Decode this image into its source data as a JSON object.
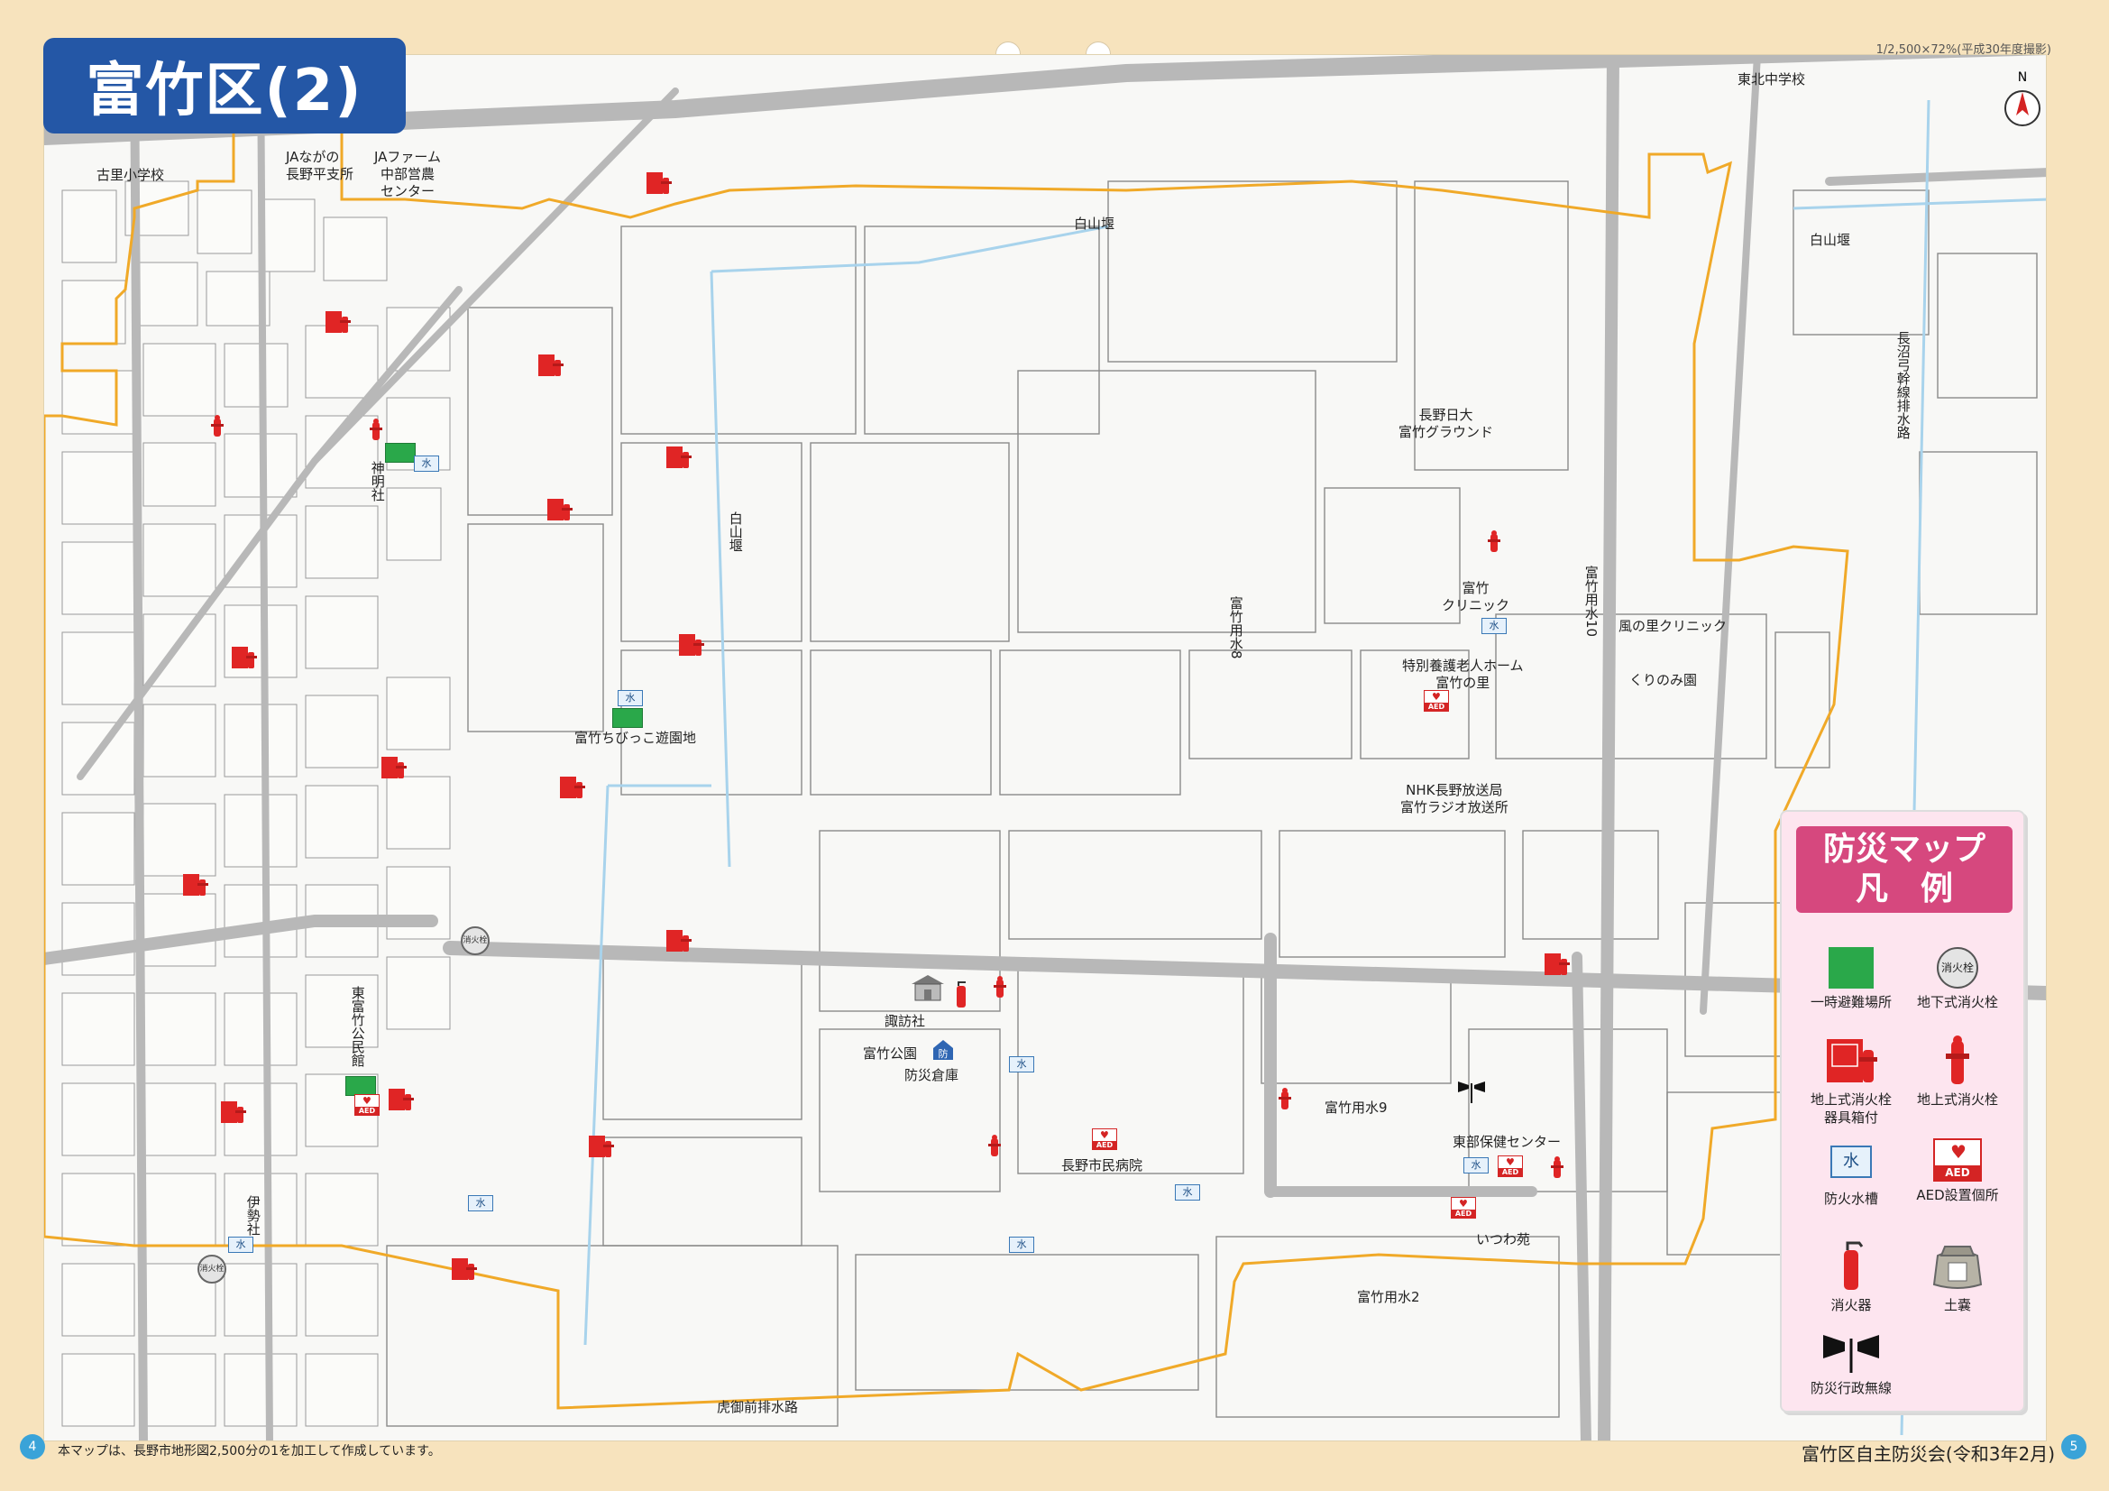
{
  "page": {
    "title": "富竹区(2)",
    "scale_note": "1/2,500×72%(平成30年度撮影)",
    "footnote": "本マップは、長野市地形図2,500分の1を加工して作成しています。",
    "credit": "富竹区自主防災会(令和3年2月)",
    "page_left": "4",
    "page_right": "5",
    "north": "N"
  },
  "colors": {
    "title_bg": "#2457a6",
    "boundary": "#f0a928",
    "legend_bg": "#fde5ef",
    "legend_title_bg": "#d6487e",
    "evacuation_green": "#2aa84a",
    "hydrant_red": "#e02525"
  },
  "map": {
    "labels": {
      "furusato_school": "古里小学校",
      "ja_nagano": "JAながの\n長野平支所",
      "ja_farm": "JAファーム\n中部営農\nセンター",
      "tohoku_jhs": "東北中学校",
      "shiroyama_seki_top": "白山堰",
      "shiroyama_seki_right": "白山堰",
      "shiroyama_seki_mid": "白山堰",
      "nagano_nichidai": "長野日大\n富竹グラウンド",
      "shinmei_sha": "神明社",
      "tomitake_clinic": "富竹\nクリニック",
      "kazenosato_clinic": "風の里クリニック",
      "kurinomien": "くりのみ園",
      "tokubetsu_home": "特別養護老人ホーム\n富竹の里",
      "tomitake_yousui8": "富竹用水8",
      "tomitake_yousui10": "富竹用水10",
      "chibikko_park": "富竹ちびっこ遊園地",
      "nhk": "NHK長野放送局\n富竹ラジオ放送所",
      "naganuma_drain": "長沼弓幹線排水路",
      "higashi_tomitake_hall": "東富竹公民館",
      "suwa_sha": "諏訪社",
      "tomitake_park": "富竹公園",
      "bousai_soko": "防災倉庫",
      "nagano_hospital": "長野市民病院",
      "tomitake_yousui9": "富竹用水9",
      "east_health_center": "東部保健センター",
      "itsuwa_en": "いつわ苑",
      "tomitake_yousui2": "富竹用水2",
      "ise_sha": "伊勢社",
      "toragozen_drain": "虎御前排水路"
    },
    "icon_text": {
      "mizu": "水",
      "aed": "AED",
      "bou": "防",
      "underground": "消火栓"
    }
  },
  "legend": {
    "title": "防災マップ\n凡　例",
    "items": [
      {
        "key": "evacuation",
        "label": "一時避難場所"
      },
      {
        "key": "underground_hydrant",
        "label": "地下式消火栓"
      },
      {
        "key": "hydrant_box",
        "label": "地上式消火栓\n器具箱付"
      },
      {
        "key": "hydrant",
        "label": "地上式消火栓"
      },
      {
        "key": "water_tank",
        "label": "防火水槽"
      },
      {
        "key": "aed",
        "label": "AED設置個所"
      },
      {
        "key": "extinguisher",
        "label": "消火器"
      },
      {
        "key": "sandbag",
        "label": "土嚢"
      },
      {
        "key": "radio",
        "label": "防災行政無線"
      }
    ]
  }
}
